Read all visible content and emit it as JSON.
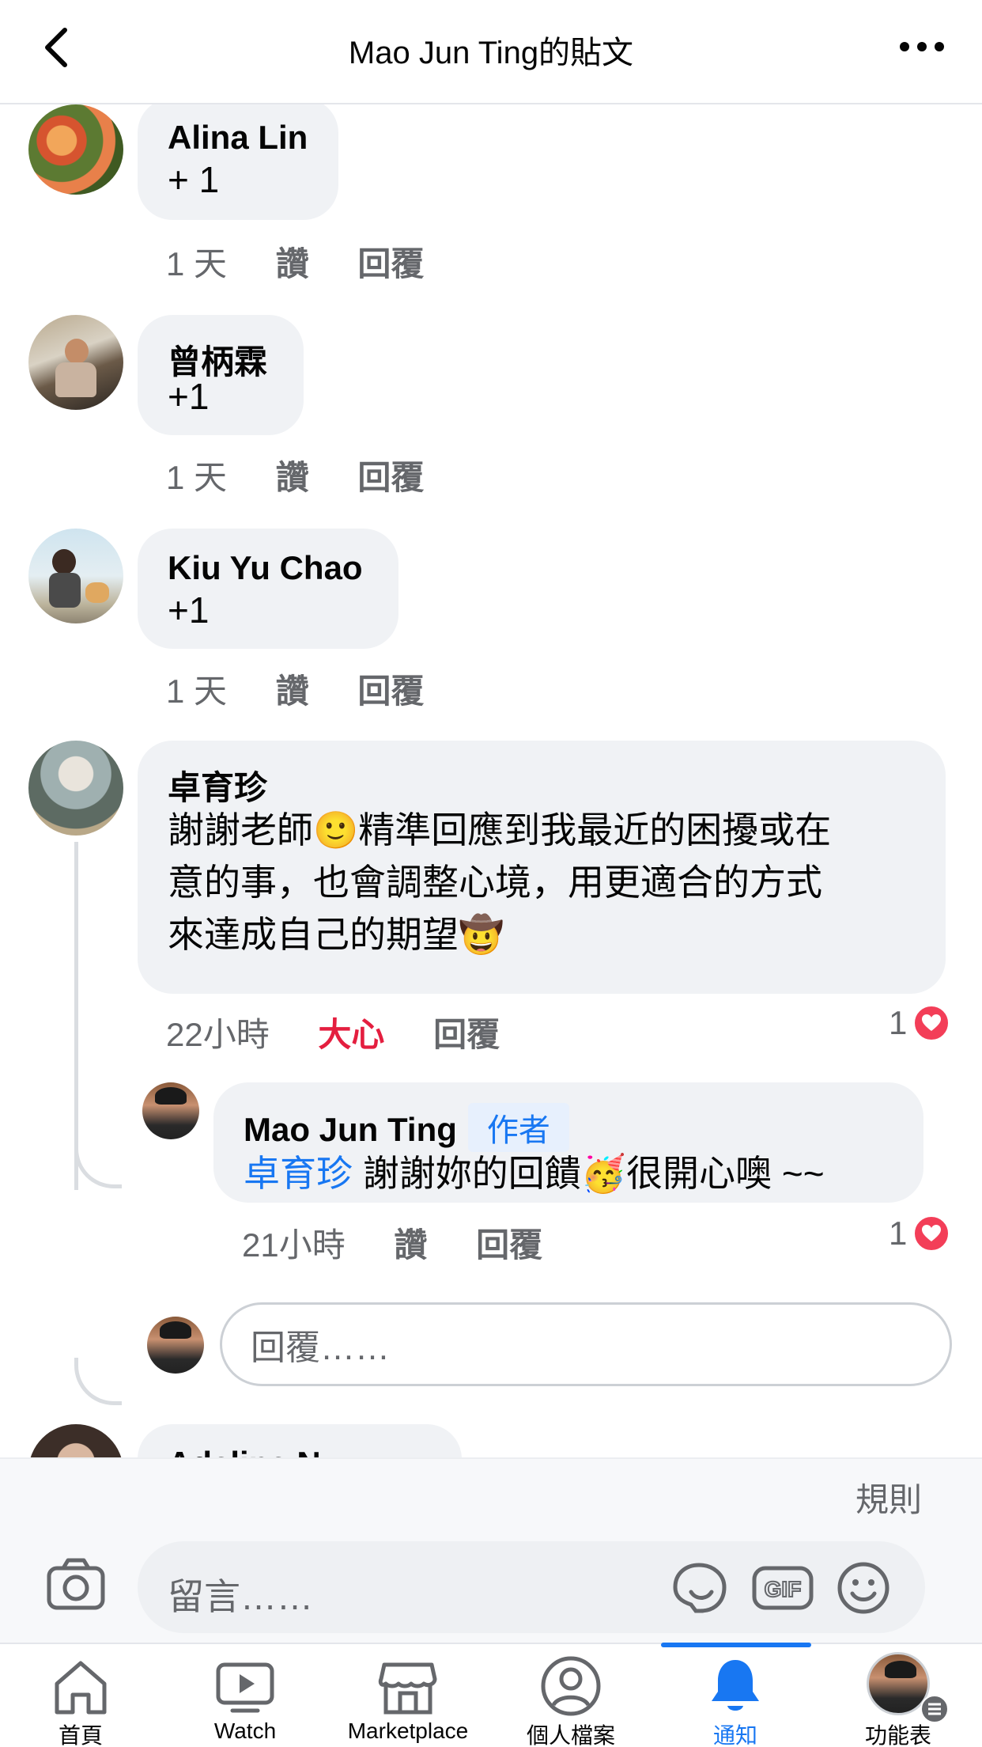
{
  "header": {
    "title": "Mao Jun Ting的貼文"
  },
  "comments": [
    {
      "name": "Alina Lin",
      "text": "+ 1",
      "time": "1 天",
      "like": "讚",
      "reply": "回覆"
    },
    {
      "name": "曾柄霖",
      "text": "+1",
      "time": "1 天",
      "like": "讚",
      "reply": "回覆"
    },
    {
      "name": "Kiu Yu Chao",
      "text": "+1",
      "time": "1 天",
      "like": "讚",
      "reply": "回覆"
    },
    {
      "name": "卓育珍",
      "text_lines": [
        "謝謝老師🙂精準回應到我最近的困擾或在",
        "意的事，也會調整心境，用更適合的方式",
        "來達成自己的期望🤠"
      ],
      "time": "22小時",
      "reaction": "大心",
      "reply": "回覆",
      "react_count": "1"
    }
  ],
  "reply_item": {
    "name": "Mao Jun Ting",
    "badge": "作者",
    "mention": "卓育珍",
    "text": "謝謝妳的回饋🥳很開心噢 ~~",
    "time": "21小時",
    "like": "讚",
    "reply": "回覆",
    "react_count": "1"
  },
  "reply_input": {
    "placeholder": "回覆……"
  },
  "next_comment_partial": {
    "name": "Adeline N"
  },
  "rules_label": "規則",
  "composer": {
    "placeholder": "留言……"
  },
  "tabs": [
    {
      "label": "首頁",
      "icon": "home-icon"
    },
    {
      "label": "Watch",
      "icon": "watch-icon"
    },
    {
      "label": "Marketplace",
      "icon": "marketplace-icon"
    },
    {
      "label": "個人檔案",
      "icon": "profile-icon"
    },
    {
      "label": "通知",
      "icon": "bell-icon",
      "active": true
    },
    {
      "label": "功能表",
      "icon": "menu-avatar-icon"
    }
  ],
  "colors": {
    "accent": "#1877f2",
    "love": "#f33e58",
    "bubble": "#f0f2f5",
    "secondary_text": "#65676b"
  }
}
